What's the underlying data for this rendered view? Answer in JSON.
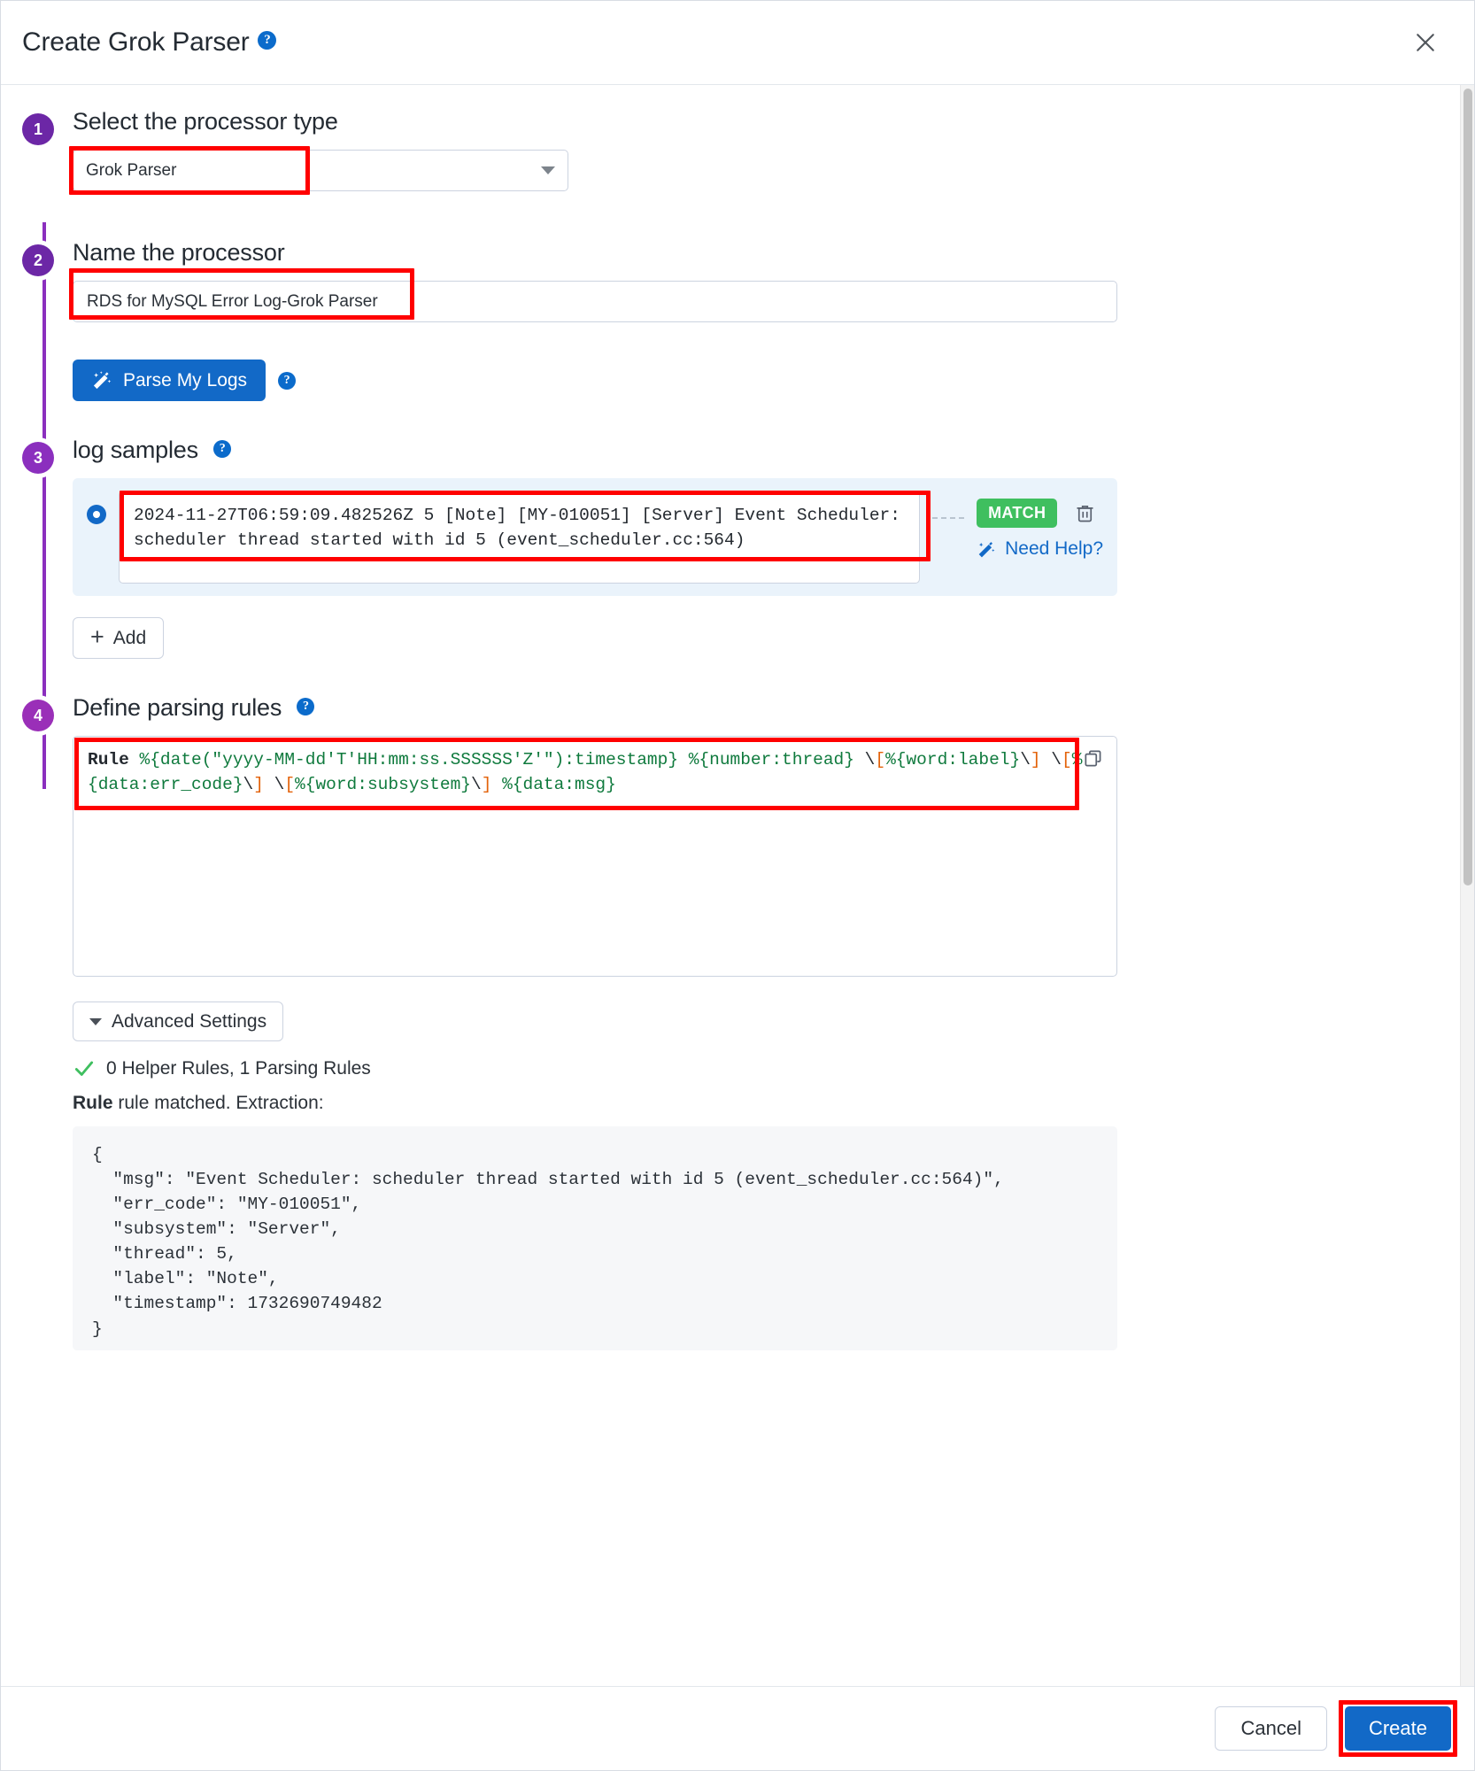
{
  "header": {
    "title": "Create Grok Parser",
    "help_icon": "help-circle-icon",
    "help_glyph": "?",
    "close_icon": "close-icon"
  },
  "steps": [
    {
      "number": "1",
      "title": "Select the processor type"
    },
    {
      "number": "2",
      "title": "Name the processor"
    },
    {
      "number": "3",
      "title": "log samples"
    },
    {
      "number": "4",
      "title": "Define parsing rules"
    }
  ],
  "processor_type": {
    "selected": "Grok Parser",
    "caret_icon": "chevron-down-icon"
  },
  "processor_name": {
    "value": "RDS for MySQL Error Log-Grok Parser",
    "placeholder": "Name the processor"
  },
  "parse_button": {
    "label": "Parse My Logs",
    "icon": "magic-wand-icon",
    "help_glyph": "?"
  },
  "log_samples": {
    "section_help_glyph": "?",
    "sample": "2024-11-27T06:59:09.482526Z 5 [Note] [MY-010051] [Server] Event Scheduler: scheduler thread started with id 5 (event_scheduler.cc:564)",
    "status_badge": "MATCH",
    "delete_icon": "trash-icon",
    "need_help_label": "Need Help?",
    "need_help_icon": "magic-wand-icon",
    "radio_icon": "radio-selected-icon",
    "add_label": "Add",
    "add_icon": "plus-icon"
  },
  "parsing_rules": {
    "section_help_glyph": "?",
    "copy_icon": "copy-icon",
    "rule_name": "Rule",
    "rule_tokens": [
      {
        "t": "Rule ",
        "c": "kw"
      },
      {
        "t": "%{date(\"yyyy-MM-dd'T'HH:mm:ss.SSSSSS'Z'\"):timestamp} %{number:thread} ",
        "c": "g"
      },
      {
        "t": "\\",
        "c": "esc"
      },
      {
        "t": "[",
        "c": "br"
      },
      {
        "t": "%{word:label}",
        "c": "g"
      },
      {
        "t": "\\",
        "c": "esc"
      },
      {
        "t": "]",
        "c": "br"
      },
      {
        "t": " ",
        "c": "g"
      },
      {
        "t": "\\",
        "c": "esc"
      },
      {
        "t": "[",
        "c": "br"
      },
      {
        "t": "%{data:err_code}",
        "c": "g"
      },
      {
        "t": "\\",
        "c": "esc"
      },
      {
        "t": "]",
        "c": "br"
      },
      {
        "t": " ",
        "c": "g"
      },
      {
        "t": "\\",
        "c": "esc"
      },
      {
        "t": "[",
        "c": "br"
      },
      {
        "t": "%{word:subsystem}",
        "c": "g"
      },
      {
        "t": "\\",
        "c": "esc"
      },
      {
        "t": "]",
        "c": "br"
      },
      {
        "t": " %{data:msg}",
        "c": "g"
      }
    ],
    "rule_plain": "Rule %{date(\"yyyy-MM-dd'T'HH:mm:ss.SSSSSS'Z'\"):timestamp} %{number:thread} \\[%{word:label}\\] \\[%{data:err_code}\\] \\[%{word:subsystem}\\] %{data:msg}"
  },
  "advanced": {
    "label": "Advanced Settings",
    "caret_icon": "chevron-down-icon"
  },
  "results": {
    "check_icon": "check-icon",
    "rules_summary": "0 Helper Rules, 1 Parsing Rules",
    "extraction_rule_name": "Rule",
    "extraction_text": " rule matched. Extraction:",
    "json_output": "{\n  \"msg\": \"Event Scheduler: scheduler thread started with id 5 (event_scheduler.cc:564)\",\n  \"err_code\": \"MY-010051\",\n  \"subsystem\": \"Server\",\n  \"thread\": 5,\n  \"label\": \"Note\",\n  \"timestamp\": 1732690749482\n}"
  },
  "footer": {
    "cancel_label": "Cancel",
    "create_label": "Create"
  },
  "colors": {
    "step_purple": "#6c27a6",
    "primary_blue": "#1269c7",
    "match_green": "#3fbf5f",
    "annotation_red": "#ff0000",
    "grok_green": "#0f7a3d",
    "bracket_orange": "#e36209"
  }
}
